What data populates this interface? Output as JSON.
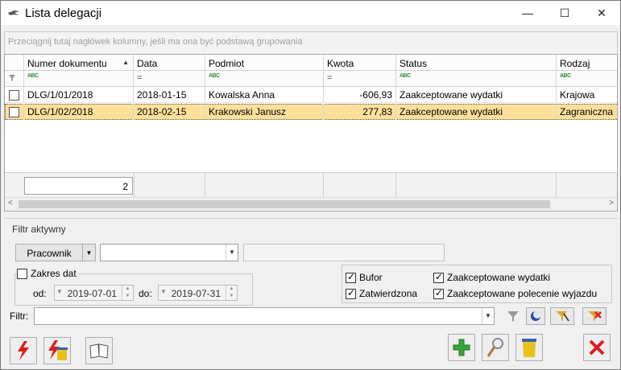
{
  "window": {
    "title": "Lista delegacji",
    "minimize": "—",
    "maximize": "☐",
    "close": "✕"
  },
  "grid": {
    "group_hint": "Przeciągnij tutaj nagłówek kolumny, jeśli ma ona być podstawą grupowania",
    "columns": [
      "Numer dokumentu",
      "Data",
      "Podmiot",
      "Kwota",
      "Status",
      "Rodzaj"
    ],
    "filter_row": [
      "ABC",
      "=",
      "ABC",
      "=",
      "ABC",
      "ABC"
    ],
    "rows": [
      {
        "numer": "DLG/1/01/2018",
        "data": "2018-01-15",
        "podmiot": "Kowalska Anna",
        "kwota": "-606,93",
        "status": "Zaakceptowane wydatki",
        "rodzaj": "Krajowa"
      },
      {
        "numer": "DLG/1/02/2018",
        "data": "2018-02-15",
        "podmiot": "Krakowski Janusz",
        "kwota": "277,83",
        "status": "Zaakceptowane wydatki",
        "rodzaj": "Zagraniczna"
      }
    ],
    "count": "2"
  },
  "filter": {
    "label": "Filtr aktywny",
    "pracownik_button": "Pracownik",
    "zakres_dat": "Zakres dat",
    "od_label": "od:",
    "od_value": "2019-07-01",
    "do_label": "do:",
    "do_value": "2019-07-31",
    "checks": {
      "bufor": "Bufor",
      "zatwierdzona": "Zatwierdzona",
      "zaakc_wydatki": "Zaakceptowane wydatki",
      "zaakc_polecenie": "Zaakceptowane polecenie wyjazdu"
    },
    "filtr_label": "Filtr:"
  },
  "colors": {
    "selected_row": "#fde19a",
    "accent_red": "#d91e1e",
    "accent_green": "#3aa23a"
  }
}
